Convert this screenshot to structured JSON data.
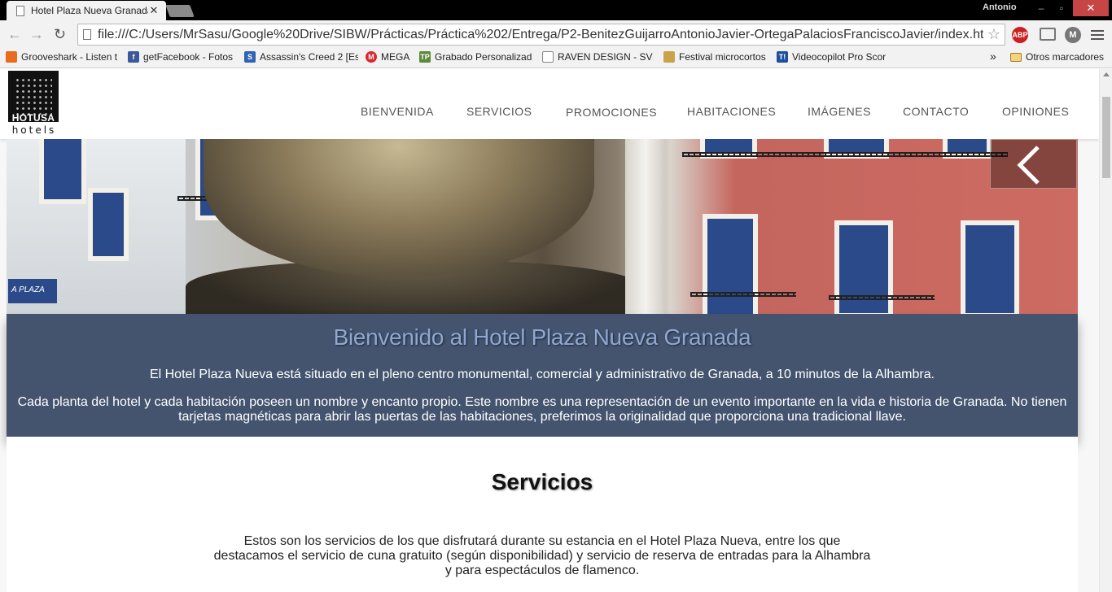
{
  "browser": {
    "tab_title": "Hotel Plaza Nueva Granada",
    "user_name": "Antonio",
    "url": "file:///C:/Users/MrSasu/Google%20Drive/SIBW/Prácticas/Práctica%202/Entrega/P2-BenitezGuijarroAntonioJavier-OrtegaPalaciosFranciscoJavier/index.html",
    "abp_label": "ABP",
    "m_label": "M",
    "bookmarks": [
      {
        "label": "Grooveshark - Listen t",
        "icon": "grooveshark-icon",
        "color": "#e86b1f"
      },
      {
        "label": "getFacebook - Fotos",
        "icon": "facebook-icon",
        "color": "#3b5998"
      },
      {
        "label": "Assassin's Creed 2 [Es",
        "icon": "s-icon",
        "color": "#2f64b5"
      },
      {
        "label": "MEGA",
        "icon": "mega-icon",
        "color": "#d9272e"
      },
      {
        "label": "Grabado Personalizad",
        "icon": "tp-icon",
        "color": "#5a8a3a"
      },
      {
        "label": "RAVEN DESIGN - SVP",
        "icon": "page-icon",
        "color": "#888888"
      },
      {
        "label": "Festival microcortos",
        "icon": "festival-icon",
        "color": "#c9a34a"
      },
      {
        "label": "Videocopilot Pro Scor",
        "icon": "videocopilot-icon",
        "color": "#1e4f9c"
      }
    ],
    "overflow_chevron": "»",
    "other_bookmarks": "Otros marcadores"
  },
  "site": {
    "logo_word": "HOTUSA",
    "logo_sub": "hotels",
    "nav": [
      "BIENVENIDA",
      "SERVICIOS",
      "PROMOCIONES",
      "HABITACIONES",
      "IMÁGENES",
      "CONTACTO",
      "OPINIONES"
    ],
    "welcome": {
      "title": "Bienvenido al Hotel Plaza Nueva Granada",
      "p1": "El Hotel Plaza Nueva está situado en el pleno centro monumental, comercial y administrativo de Granada, a 10 minutos de la Alhambra.",
      "p2": "Cada planta del hotel y cada habitación poseen un nombre y encanto propio. Este nombre es una representación de un evento importante en la vida e historia de Granada. No tienen tarjetas magnéticas para abrir las puertas de las habitaciones, preferimos la originalidad que proporciona una tradicional llave."
    },
    "services": {
      "title": "Servicios",
      "text": "Estos son los servicios de los que disfrutará durante su estancia en el Hotel Plaza Nueva, entre los que destacamos el servicio de cuna gratuito (según disponibilidad) y servicio de reserva de entradas para la Alhambra y para espectáculos de flamenco."
    },
    "hero_plaque": "A PLAZA",
    "colors": {
      "banner": "#44546f",
      "banner_title": "#8fa8d1",
      "nav_text": "#555555"
    }
  }
}
